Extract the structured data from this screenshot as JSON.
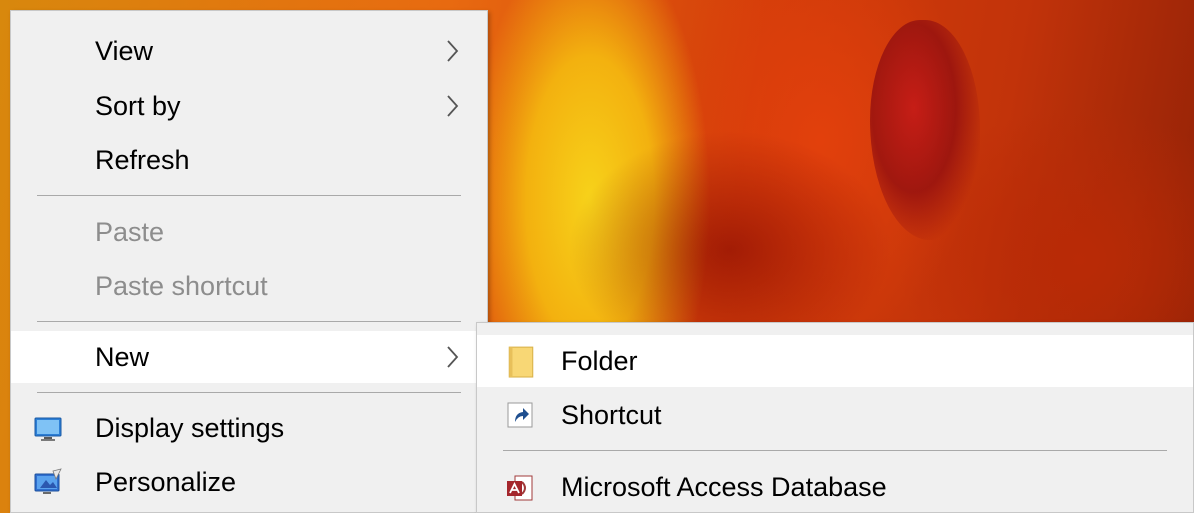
{
  "context_menu": {
    "items": [
      {
        "label": "View",
        "has_submenu": true
      },
      {
        "label": "Sort by",
        "has_submenu": true
      },
      {
        "label": "Refresh"
      },
      {
        "label": "Paste",
        "disabled": true
      },
      {
        "label": "Paste shortcut",
        "disabled": true
      },
      {
        "label": "New",
        "has_submenu": true,
        "highlighted": true
      },
      {
        "label": "Display settings",
        "icon": "display-icon"
      },
      {
        "label": "Personalize",
        "icon": "personalize-icon"
      }
    ]
  },
  "new_submenu": {
    "items": [
      {
        "label": "Folder",
        "icon": "folder-icon",
        "highlighted": true
      },
      {
        "label": "Shortcut",
        "icon": "shortcut-icon"
      },
      {
        "label": "Microsoft Access Database",
        "icon": "access-icon"
      }
    ]
  },
  "colors": {
    "menu_background": "#f0f0f0",
    "highlight": "#ffffff",
    "disabled_text": "#8d8d8d"
  }
}
